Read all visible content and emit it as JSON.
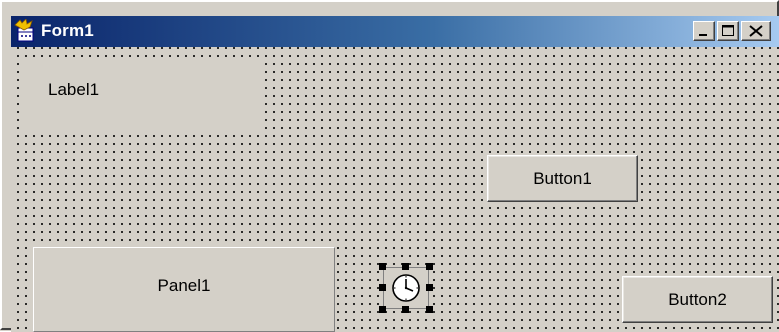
{
  "window": {
    "title": "Form1",
    "app_icon": "delphi-form-icon",
    "caption_buttons": [
      "minimize-icon",
      "maximize-icon",
      "close-icon"
    ]
  },
  "form": {
    "label": "Label1",
    "button1": "Button1",
    "button2": "Button2",
    "panel": "Panel1",
    "timer_icon": "clock-icon",
    "grid": "dotted-design-grid"
  },
  "colors": {
    "titlebar_start": "#0a246a",
    "titlebar_end": "#a6caf0",
    "face": "#d4d0c8"
  }
}
